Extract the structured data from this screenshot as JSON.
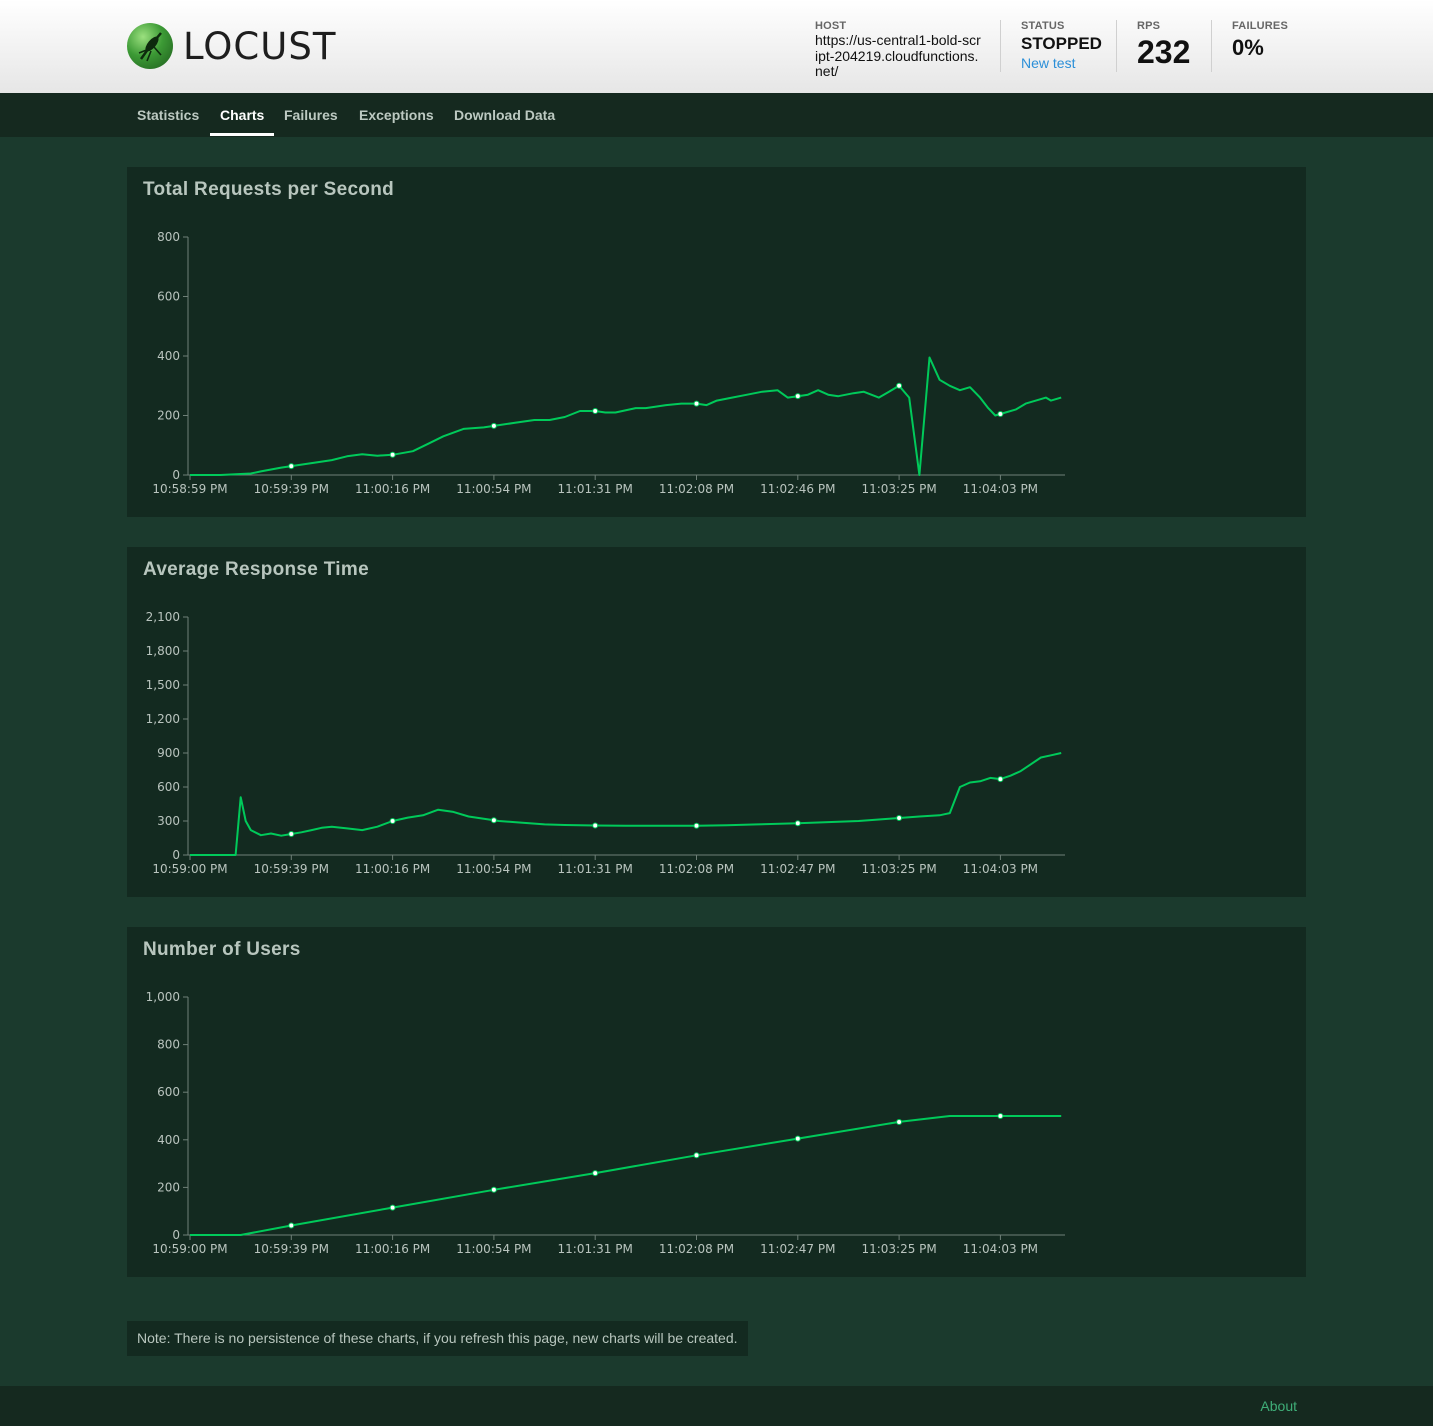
{
  "app": {
    "logo_text": "LOCUST"
  },
  "header": {
    "host_label": "HOST",
    "host_value": "https://us-central1-bold-script-204219.cloudfunctions.net/",
    "status_label": "STATUS",
    "status_value": "STOPPED",
    "new_test_label": "New test",
    "rps_label": "RPS",
    "rps_value": "232",
    "failures_label": "FAILURES",
    "failures_value": "0%"
  },
  "nav": {
    "tabs": [
      {
        "label": "Statistics"
      },
      {
        "label": "Charts",
        "active": true
      },
      {
        "label": "Failures"
      },
      {
        "label": "Exceptions"
      },
      {
        "label": "Download Data"
      }
    ]
  },
  "colors": {
    "line": "#00ca5a",
    "background": "#1b3a2d",
    "panel": "#132a20"
  },
  "chart_data": [
    {
      "type": "line",
      "title": "Total Requests per Second",
      "ylim": [
        0,
        800
      ],
      "yticks": [
        "0",
        "200",
        "400",
        "600",
        "800"
      ],
      "xtick_labels": [
        "10:58:59 PM",
        "10:59:39 PM",
        "11:00:16 PM",
        "11:00:54 PM",
        "11:01:31 PM",
        "11:02:08 PM",
        "11:02:46 PM",
        "11:03:25 PM",
        "11:04:03 PM"
      ],
      "x_range": [
        0,
        8.6
      ],
      "x": [
        0,
        0.3,
        0.6,
        0.7,
        0.9,
        1.0,
        1.2,
        1.4,
        1.55,
        1.7,
        1.85,
        2.0,
        2.2,
        2.35,
        2.5,
        2.7,
        2.9,
        3.0,
        3.2,
        3.4,
        3.55,
        3.7,
        3.85,
        4.0,
        4.1,
        4.2,
        4.4,
        4.5,
        4.7,
        4.85,
        5.0,
        5.1,
        5.2,
        5.35,
        5.5,
        5.65,
        5.8,
        5.9,
        6.0,
        6.1,
        6.2,
        6.3,
        6.4,
        6.55,
        6.65,
        6.8,
        6.9,
        7.0,
        7.1,
        7.2,
        7.3,
        7.4,
        7.5,
        7.6,
        7.7,
        7.8,
        7.88,
        7.95,
        8.05,
        8.15,
        8.25,
        8.35,
        8.45,
        8.5,
        8.6
      ],
      "y": [
        0,
        0,
        5,
        12,
        25,
        30,
        40,
        50,
        63,
        70,
        65,
        68,
        80,
        105,
        130,
        155,
        160,
        165,
        175,
        185,
        185,
        195,
        215,
        215,
        210,
        210,
        225,
        225,
        235,
        240,
        240,
        235,
        250,
        260,
        270,
        280,
        285,
        260,
        265,
        270,
        285,
        270,
        265,
        275,
        280,
        260,
        280,
        300,
        260,
        0,
        395,
        320,
        300,
        285,
        295,
        260,
        225,
        200,
        210,
        220,
        240,
        250,
        260,
        250,
        260
      ],
      "markers_x": [
        1,
        2,
        3,
        4,
        5,
        6,
        7,
        8
      ]
    },
    {
      "type": "line",
      "title": "Average Response Time",
      "ylim": [
        0,
        2100
      ],
      "yticks": [
        "0",
        "300",
        "600",
        "900",
        "1,200",
        "1,500",
        "1,800",
        "2,100"
      ],
      "xtick_labels": [
        "10:59:00 PM",
        "10:59:39 PM",
        "11:00:16 PM",
        "11:00:54 PM",
        "11:01:31 PM",
        "11:02:08 PM",
        "11:02:47 PM",
        "11:03:25 PM",
        "11:04:03 PM"
      ],
      "x_range": [
        0,
        8.6
      ],
      "x": [
        0,
        0.45,
        0.5,
        0.55,
        0.6,
        0.7,
        0.8,
        0.9,
        1.0,
        1.1,
        1.2,
        1.3,
        1.4,
        1.55,
        1.7,
        1.85,
        2.0,
        2.15,
        2.3,
        2.45,
        2.6,
        2.75,
        2.9,
        3.05,
        3.2,
        3.35,
        3.5,
        3.7,
        4.0,
        4.3,
        4.7,
        5.0,
        5.3,
        5.6,
        6.0,
        6.3,
        6.6,
        6.9,
        7.2,
        7.4,
        7.45,
        7.5,
        7.6,
        7.7,
        7.8,
        7.9,
        8.0,
        8.1,
        8.2,
        8.3,
        8.4,
        8.5,
        8.6
      ],
      "y": [
        0,
        0,
        510,
        300,
        220,
        175,
        190,
        170,
        185,
        200,
        220,
        240,
        250,
        235,
        220,
        250,
        300,
        330,
        350,
        400,
        380,
        340,
        320,
        300,
        290,
        280,
        270,
        265,
        260,
        258,
        258,
        258,
        262,
        270,
        280,
        290,
        300,
        320,
        340,
        350,
        360,
        370,
        600,
        640,
        650,
        680,
        670,
        700,
        740,
        800,
        860,
        880,
        900
      ],
      "markers_x": [
        1,
        2,
        3,
        4,
        5,
        6,
        7,
        8
      ]
    },
    {
      "type": "line",
      "title": "Number of Users",
      "ylim": [
        0,
        1000
      ],
      "yticks": [
        "0",
        "200",
        "400",
        "600",
        "800",
        "1,000"
      ],
      "xtick_labels": [
        "10:59:00 PM",
        "10:59:39 PM",
        "11:00:16 PM",
        "11:00:54 PM",
        "11:01:31 PM",
        "11:02:08 PM",
        "11:02:47 PM",
        "11:03:25 PM",
        "11:04:03 PM"
      ],
      "x_range": [
        0,
        8.6
      ],
      "x": [
        0,
        0.5,
        1,
        2,
        3,
        4,
        5,
        6,
        7,
        7.5,
        8,
        8.6
      ],
      "y": [
        0,
        0,
        40,
        115,
        190,
        260,
        335,
        405,
        475,
        500,
        500,
        500
      ],
      "markers_x": [
        1,
        2,
        3,
        4,
        5,
        6,
        7,
        8
      ]
    }
  ],
  "note": "Note: There is no persistence of these charts, if you refresh this page, new charts will be created.",
  "footer": {
    "about_label": "About"
  }
}
